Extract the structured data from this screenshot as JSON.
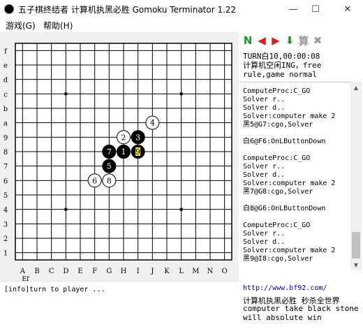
{
  "window": {
    "title": "五子棋终结者 计算机执黑必胜 Gomoku Terminator 1.22",
    "minimize": "—",
    "maximize": "☐",
    "close": "✕"
  },
  "menu": [
    {
      "label": "游戏(G)"
    },
    {
      "label": "帮助(H)"
    }
  ],
  "board": {
    "col_labels": [
      "A",
      "B",
      "C",
      "D",
      "E",
      "F",
      "G",
      "H",
      "I",
      "J",
      "K",
      "L",
      "M",
      "N",
      "O"
    ],
    "row_labels": [
      "1",
      "2",
      "3",
      "4",
      "5",
      "6",
      "7",
      "8",
      "9",
      "a",
      "b",
      "c",
      "d",
      "e",
      "f"
    ],
    "extra_label": "Ef",
    "star_points": [
      [
        "D",
        "4"
      ],
      [
        "L",
        "4"
      ],
      [
        "D",
        "c"
      ],
      [
        "L",
        "c"
      ]
    ],
    "stones": [
      {
        "col": "H",
        "row": "8",
        "color": "black",
        "n": "1"
      },
      {
        "col": "H",
        "row": "9",
        "color": "white",
        "n": "2"
      },
      {
        "col": "I",
        "row": "9",
        "color": "black",
        "n": "3"
      },
      {
        "col": "J",
        "row": "a",
        "color": "white",
        "n": "4"
      },
      {
        "col": "G",
        "row": "7",
        "color": "black",
        "n": "5"
      },
      {
        "col": "F",
        "row": "6",
        "color": "white",
        "n": "6"
      },
      {
        "col": "G",
        "row": "8",
        "color": "black",
        "n": "7"
      },
      {
        "col": "G",
        "row": "6",
        "color": "white",
        "n": "8"
      },
      {
        "col": "I",
        "row": "8",
        "color": "black",
        "n": "9",
        "last": true
      }
    ]
  },
  "toolbar": [
    {
      "icon": "new-game-icon",
      "glyph": "N",
      "color": "#1a9a2a"
    },
    {
      "icon": "undo-icon",
      "glyph": "◀",
      "color": "#d42020"
    },
    {
      "icon": "redo-icon",
      "glyph": "▶",
      "color": "#d42020"
    },
    {
      "icon": "download-icon",
      "glyph": "⬇",
      "color": "#1a9a2a"
    },
    {
      "icon": "compute-icon",
      "glyph": "算",
      "color": "#9a9a9a"
    },
    {
      "icon": "stop-icon",
      "glyph": "✖",
      "color": "#9a9a9a"
    }
  ],
  "turn_info": {
    "line1": "TURN白10,00:00:08",
    "line2": "计算机空闲ING，free",
    "line3": "rule,game normal"
  },
  "log": [
    "ComputeProc:C_GO",
    "Solver r..",
    "Solver d..",
    "Solver:computer make 2",
    "黑5@G7:cgo,Solver",
    "",
    "白6@F6:OnLButtonDown",
    "",
    "ComputeProc:C_GO",
    "Solver r..",
    "Solver d..",
    "Solver:computer make 2",
    "黑7@G8:cgo,Solver",
    "",
    "白8@G6:OnLButtonDown",
    "",
    "ComputeProc:C_GO",
    "Solver r..",
    "Solver d..",
    "Solver:computer make 2",
    "黑9@I8:cgo,Solver"
  ],
  "status": "[info]turn to player ...",
  "promo": {
    "url": "http://www.bf92.com/",
    "line1": "计算机执黑必胜 秒杀全世界",
    "line2": "computer take black stone",
    "line3": "will absolute win"
  }
}
